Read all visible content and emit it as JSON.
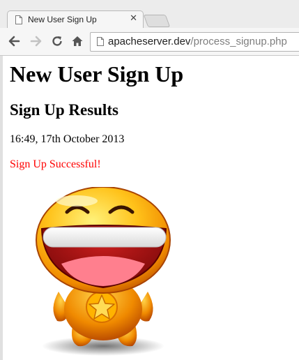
{
  "browser": {
    "tab": {
      "title": "New User Sign Up",
      "close_icon": "close-icon",
      "page_icon": "page-icon"
    },
    "new_tab_icon": "new-tab-button",
    "toolbar": {
      "back_icon": "back-arrow-icon",
      "forward_icon": "forward-arrow-icon",
      "reload_icon": "reload-icon",
      "home_icon": "home-icon"
    },
    "address_bar": {
      "host": "apacheserver.dev",
      "path": "/process_signup.php"
    }
  },
  "page": {
    "title": "New User Sign Up",
    "subtitle": "Sign Up Results",
    "timestamp": "16:49, 17th October 2013",
    "status": {
      "text": "Sign Up Successful!",
      "color": "#ff0000"
    },
    "image": {
      "icon": "laughing-smiley-mascot-icon"
    }
  }
}
